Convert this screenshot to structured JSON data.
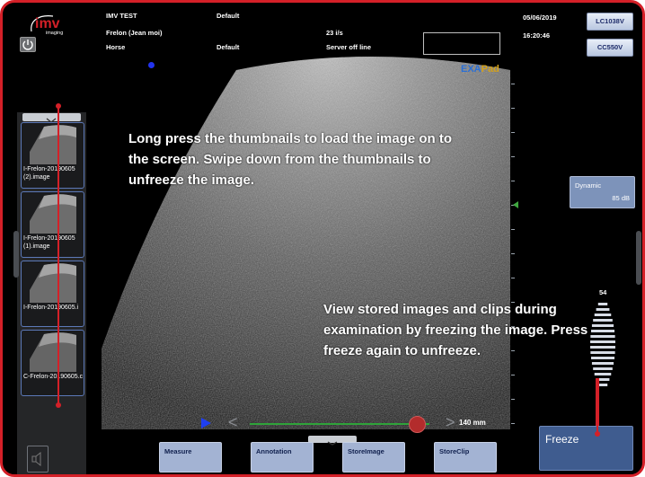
{
  "header": {
    "patient_name_top": "IMV TEST",
    "patient_owner": "Frelon (Jean moi)",
    "species": "Horse",
    "preset_top": "Default",
    "preset_bottom": "Default",
    "frame_rate": "23 i/s",
    "server_status": "Server off line",
    "date": "05/06/2019",
    "time": "16:20:46"
  },
  "logo": {
    "brand": "imv",
    "subtitle": "imaging"
  },
  "probes": [
    "LC1038V",
    "CC550V"
  ],
  "product": {
    "exa": "EXA",
    "pad": "Pad"
  },
  "thumbnails": [
    {
      "caption": "I-Frelon-20190605(2).image"
    },
    {
      "caption": "I-Frelon-20190605(1).image"
    },
    {
      "caption": "I-Frelon-20190605.i"
    },
    {
      "caption": "C-Frelon-20190605.c"
    }
  ],
  "dynamic": {
    "label": "Dynamic",
    "value": "85 dB"
  },
  "gain": {
    "value": "54"
  },
  "depth": {
    "label": "140 mm"
  },
  "cine": {
    "position_fraction": 0.93
  },
  "bottom_buttons": [
    "Measure",
    "Annotation",
    "StoreImage",
    "StoreClip"
  ],
  "freeze_label": "Freeze",
  "callouts": {
    "thumbnails": "Long press the thumbnails to load the image on to the screen. Swipe down from the thumbnails to unfreeze the image.",
    "freeze": "View stored images and clips during examination by freezing the image. Press freeze again to unfreeze."
  },
  "colors": {
    "frame_border": "#d42028",
    "accent_blue": "#1f3ff0",
    "button_blue": "#a3b3d3",
    "freeze_blue": "#3f5c8f",
    "cine_track": "#2fa33a"
  }
}
